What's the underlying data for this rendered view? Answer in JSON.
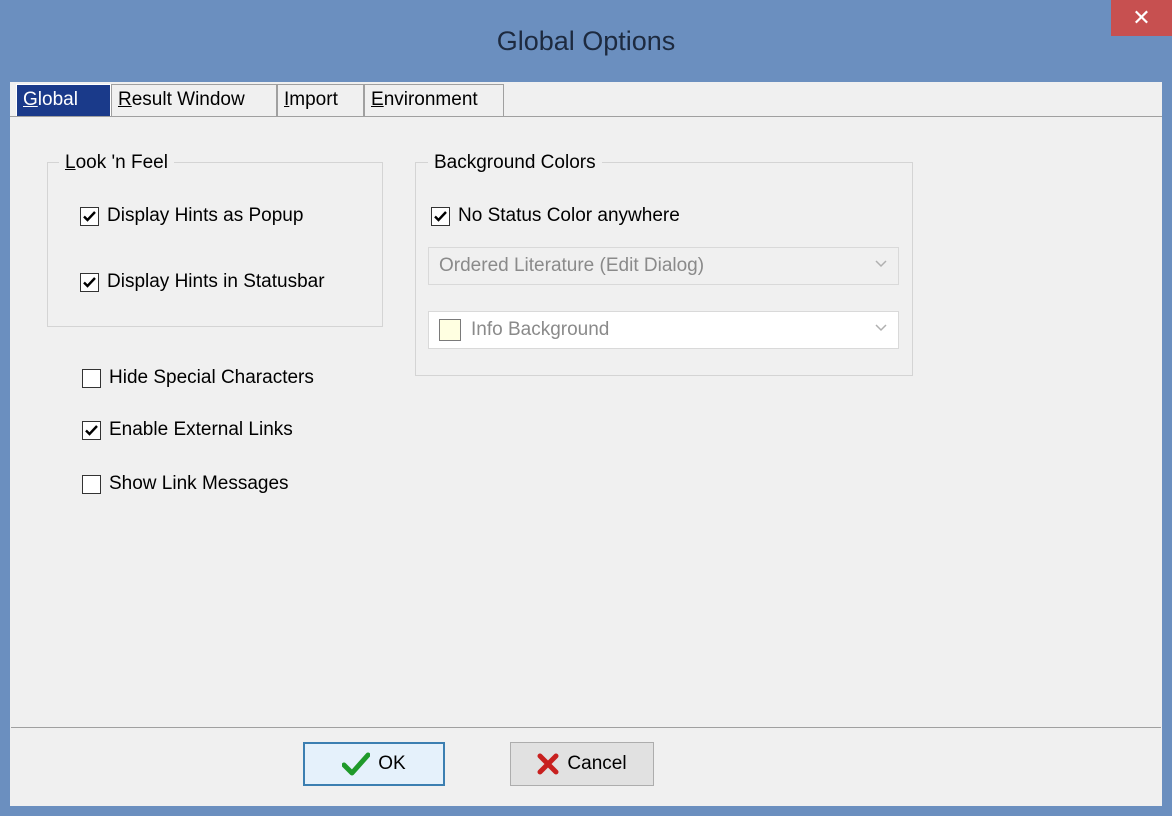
{
  "window": {
    "title": "Global Options",
    "close_glyph": "✕"
  },
  "tabs": [
    {
      "label_u": "G",
      "label_rest": "lobal",
      "active": true
    },
    {
      "label_u": "R",
      "label_rest": "esult Window",
      "active": false
    },
    {
      "label_u": "I",
      "label_rest": "mport",
      "active": false
    },
    {
      "label_u": "E",
      "label_rest": "nvironment",
      "active": false
    }
  ],
  "look_n_feel": {
    "legend_u": "L",
    "legend_rest": "ook 'n Feel",
    "display_hints_popup": {
      "label": "Display Hints as Popup",
      "checked": true
    },
    "display_hints_statusbar": {
      "label": "Display Hints in Statusbar",
      "checked": true
    }
  },
  "options": {
    "hide_special_chars": {
      "label": "Hide Special Characters",
      "checked": false
    },
    "enable_external_links": {
      "label": "Enable External Links",
      "checked": true
    },
    "show_link_messages": {
      "label": "Show Link Messages",
      "checked": false
    }
  },
  "background_colors": {
    "legend": "Background Colors",
    "no_status_color": {
      "label": "No Status Color anywhere",
      "checked": true
    },
    "status_select": {
      "value": "Ordered Literature (Edit Dialog)"
    },
    "color_select": {
      "value": "Info Background",
      "swatch": "#ffffe1"
    }
  },
  "buttons": {
    "ok": "OK",
    "cancel": "Cancel"
  },
  "icons": {
    "check": "check-mark-icon",
    "ok": "green-check-icon",
    "cancel": "red-x-icon",
    "dropdown": "chevron-down-icon"
  }
}
